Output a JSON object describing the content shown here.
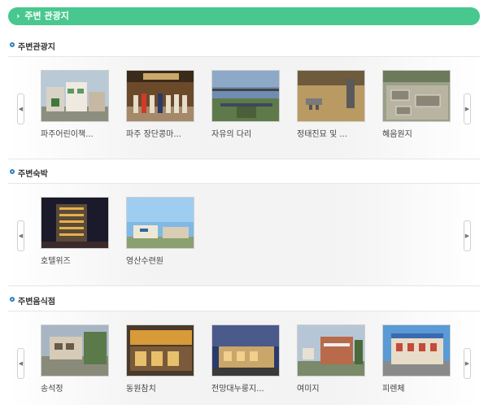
{
  "header": {
    "title": "주변 관광지"
  },
  "sections": [
    {
      "title": "주변관광지",
      "items": [
        {
          "label": "파주어린이책..."
        },
        {
          "label": "파주 장단콩마..."
        },
        {
          "label": "자유의 다리"
        },
        {
          "label": "정태진묘 및 ..."
        },
        {
          "label": "혜음원지"
        }
      ]
    },
    {
      "title": "주변숙박",
      "items": [
        {
          "label": "호텔위즈"
        },
        {
          "label": "영산수련원"
        }
      ]
    },
    {
      "title": "주변음식점",
      "items": [
        {
          "label": "송석정"
        },
        {
          "label": "동원참치"
        },
        {
          "label": "전망대누룽지..."
        },
        {
          "label": "여미지"
        },
        {
          "label": "피렌체"
        }
      ]
    }
  ],
  "nav": {
    "prev": "◀",
    "next": "▶"
  }
}
